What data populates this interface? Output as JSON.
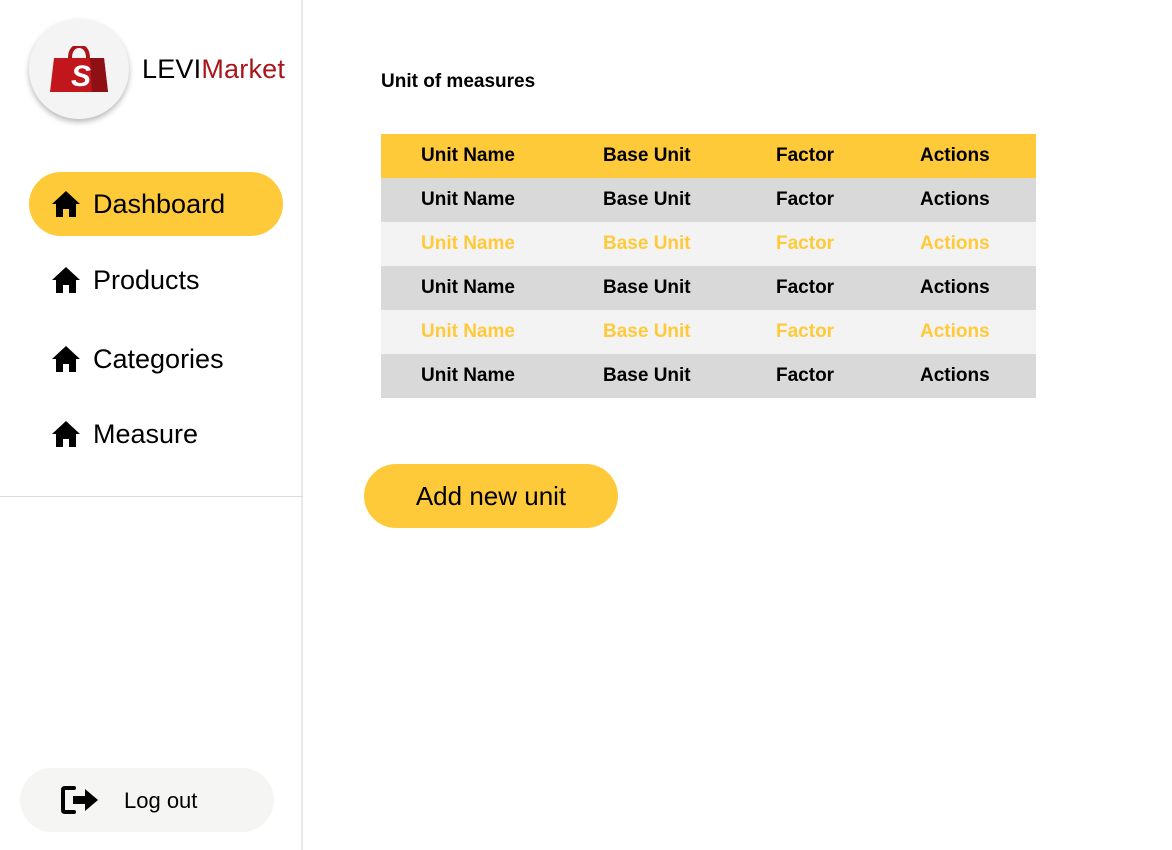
{
  "brand": {
    "part1": "LEVI",
    "part2": "Market"
  },
  "sidebar": {
    "items": [
      {
        "label": "Dashboard",
        "icon": "home-icon",
        "active": true
      },
      {
        "label": "Products",
        "icon": "home-icon",
        "active": false
      },
      {
        "label": "Categories",
        "icon": "home-icon",
        "active": false
      },
      {
        "label": "Measure",
        "icon": "home-icon",
        "active": false
      }
    ],
    "logout_label": "Log out"
  },
  "main": {
    "title": "Unit of measures",
    "table": {
      "columns": [
        "Unit Name",
        "Base Unit",
        "Factor",
        "Actions"
      ],
      "rows": [
        [
          "Unit Name",
          "Base Unit",
          "Factor",
          "Actions"
        ],
        [
          "Unit Name",
          "Base Unit",
          "Factor",
          "Actions"
        ],
        [
          "Unit Name",
          "Base Unit",
          "Factor",
          "Actions"
        ],
        [
          "Unit Name",
          "Base Unit",
          "Factor",
          "Actions"
        ],
        [
          "Unit Name",
          "Base Unit",
          "Factor",
          "Actions"
        ]
      ]
    },
    "add_button_label": "Add new unit"
  },
  "colors": {
    "accent": "#ffca3a",
    "brand_red": "#a8161b",
    "row_dark": "#d9d9d9",
    "row_light": "#f3f3f3"
  }
}
